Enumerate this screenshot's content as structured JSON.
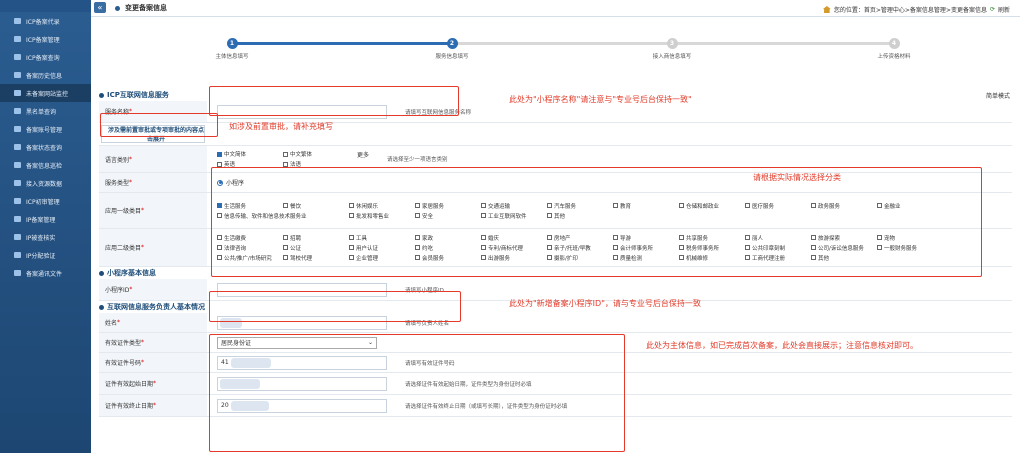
{
  "sidebar": {
    "items": [
      {
        "label": "ICP备案代录"
      },
      {
        "label": "ICP备案管理"
      },
      {
        "label": "ICP备案查询"
      },
      {
        "label": "备案历史信息"
      },
      {
        "label": "未备案网站监控"
      },
      {
        "label": "黑名单查询"
      },
      {
        "label": "备案账号管理"
      },
      {
        "label": "备案状态查询"
      },
      {
        "label": "备案信息巡检"
      },
      {
        "label": "接入资源数据"
      },
      {
        "label": "ICP初审管理"
      },
      {
        "label": "IP备案管理"
      },
      {
        "label": "IP被查核实"
      },
      {
        "label": "IP分配验证"
      },
      {
        "label": "备案通讯文件"
      }
    ]
  },
  "header": {
    "title": "变更备案信息",
    "breadcrumb": "您的位置：首页>管理中心>备案信息管理>变更备案信息",
    "refresh": "刷新"
  },
  "steps": [
    {
      "num": "1",
      "label": "主体信息填写"
    },
    {
      "num": "2",
      "label": "服务信息填写"
    },
    {
      "num": "3",
      "label": "接入商信息填写"
    },
    {
      "num": "4",
      "label": "上传资格材料"
    }
  ],
  "section_service": {
    "title": "ICP互联网信息服务",
    "simple_mode": "简单模式",
    "service_name": {
      "label": "服务名称",
      "hint": "请填写互联网信息服务名称"
    },
    "preapproval": {
      "label": "涉及需前置审批或专项审批的内容点击展开"
    },
    "language": {
      "label": "语言类别",
      "options": [
        {
          "text": "中文简体",
          "checked": true
        },
        {
          "text": "中文繁体",
          "checked": false
        },
        {
          "text": "英语",
          "checked": false
        },
        {
          "text": "法语",
          "checked": false
        }
      ],
      "more": "更多",
      "hint": "请选择至少一项语言类别"
    },
    "service_type": {
      "label": "服务类型",
      "selected": "小程序"
    },
    "category1": {
      "label": "应用一级类目",
      "options": [
        {
          "text": "生活服务",
          "checked": true
        },
        {
          "text": "餐饮",
          "checked": false
        },
        {
          "text": "休闲娱乐",
          "checked": false
        },
        {
          "text": "家居服务",
          "checked": false
        },
        {
          "text": "交通运输",
          "checked": false
        },
        {
          "text": "汽车服务",
          "checked": false
        },
        {
          "text": "教育",
          "checked": false
        },
        {
          "text": "仓储和邮政业",
          "checked": false
        },
        {
          "text": "医疗服务",
          "checked": false
        },
        {
          "text": "政务服务",
          "checked": false
        },
        {
          "text": "金融业",
          "checked": false
        },
        {
          "text": "信息传输、软件和信息技术服务业",
          "checked": false
        },
        {
          "text": "批发和零售业",
          "checked": false
        },
        {
          "text": "安全",
          "checked": false
        },
        {
          "text": "工业互联网软件",
          "checked": false
        },
        {
          "text": "其他",
          "checked": false
        }
      ]
    },
    "category2": {
      "label": "应用二级类目",
      "options": [
        {
          "text": "生活缴费"
        },
        {
          "text": "招聘"
        },
        {
          "text": "工具"
        },
        {
          "text": "家政"
        },
        {
          "text": "婚庆"
        },
        {
          "text": "房地产"
        },
        {
          "text": "导游"
        },
        {
          "text": "共享服务"
        },
        {
          "text": "丽人"
        },
        {
          "text": "旅游探索"
        },
        {
          "text": "宠物"
        },
        {
          "text": "法律咨询"
        },
        {
          "text": "公证"
        },
        {
          "text": "用户认证"
        },
        {
          "text": "约吃"
        },
        {
          "text": "专利/商标代理"
        },
        {
          "text": "亲子/托班/早教"
        },
        {
          "text": "会计师事务所"
        },
        {
          "text": "税务师事务所"
        },
        {
          "text": "公共印章刻制"
        },
        {
          "text": "公司/诉讼信息服务"
        },
        {
          "text": "一般财务服务"
        },
        {
          "text": "公共/推广/市场研究"
        },
        {
          "text": "驾校代理"
        },
        {
          "text": "企业管理"
        },
        {
          "text": "会员服务"
        },
        {
          "text": "出游服务"
        },
        {
          "text": "摄影/扩印"
        },
        {
          "text": "质量检测"
        },
        {
          "text": "机械维修"
        },
        {
          "text": "工商代理注册"
        },
        {
          "text": "其他"
        }
      ]
    }
  },
  "section_mini": {
    "title": "小程序基本信息",
    "mini_id": {
      "label": "小程序ID",
      "hint": "请填写小程序ID"
    }
  },
  "section_person": {
    "title": "互联网信息服务负责人基本情况",
    "name": {
      "label": "姓名",
      "hint": "请填写负责人姓名"
    },
    "id_type": {
      "label": "有效证件类型",
      "value": "居民身份证"
    },
    "id_number": {
      "label": "有效证件号码",
      "value": "41",
      "hint": "请填写有效证件号码"
    },
    "id_start": {
      "label": "证件有效起始日期",
      "hint": "请选择证件有效起始日期，证件类型为身份证时必填"
    },
    "id_end": {
      "label": "证件有效终止日期",
      "value": "20",
      "hint": "请选择证件有效终止日期（或填写长期），证件类型为身份证时必填"
    }
  },
  "annotations": {
    "service_name": "此处为\"小程序名称\"请注意与\"专业号后台保持一致\"",
    "preapproval": "如涉及前置审批，请补充填写",
    "category": "请根据实际情况选择分类",
    "mini_id": "此处为\"新增备案小程序ID\"，请与专业号后台保持一致",
    "person": "此处为主体信息，如已完成首次备案，此处会直接展示；注意信息核对即可。"
  },
  "colors": {
    "sidebar": "#2b5d91",
    "accent": "#2b6cb3",
    "annotation": "#e43a2a"
  }
}
